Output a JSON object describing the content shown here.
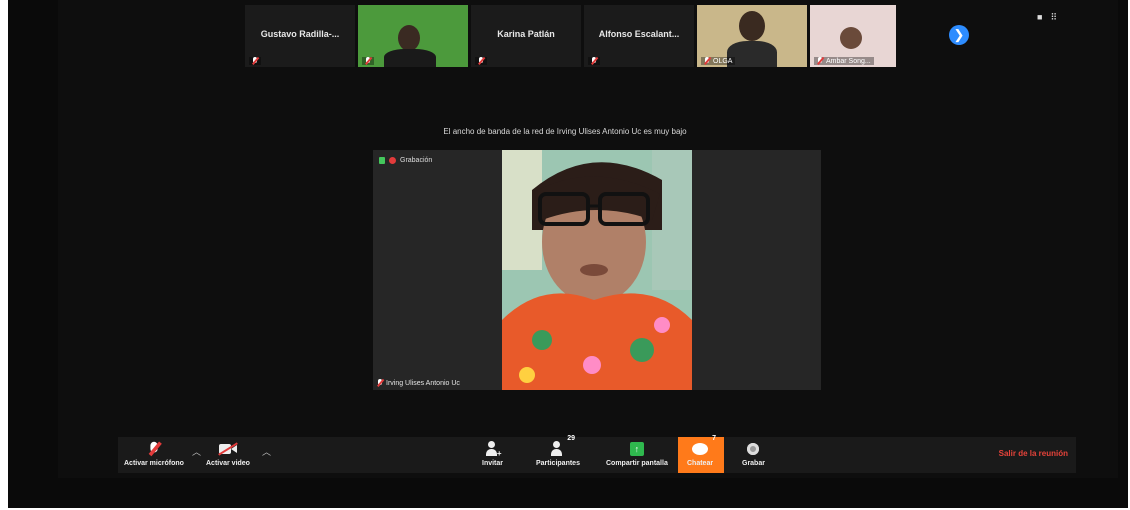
{
  "thumbnails": [
    {
      "name": "Gustavo  Radilla-...",
      "type": "name",
      "tag": ""
    },
    {
      "name": "",
      "type": "video-green",
      "tag": ""
    },
    {
      "name": "Karina Patlán",
      "type": "name",
      "tag": ""
    },
    {
      "name": "Alfonso  Escalant...",
      "type": "name",
      "tag": ""
    },
    {
      "name": "",
      "type": "video-tan",
      "tag": "OLGA"
    },
    {
      "name": "",
      "type": "video-pink",
      "tag": "Ambar Song..."
    }
  ],
  "notice": "El ancho de banda de la red de Irving Ulises Antonio Uc es muy bajo",
  "speaker": {
    "recording_label": "Grabación",
    "name": "Irving Ulises Antonio Uc"
  },
  "toolbar": {
    "mic_label": "Activar micrófono",
    "video_label": "Activar video",
    "invite_label": "Invitar",
    "participants_label": "Participantes",
    "participants_count": "29",
    "share_label": "Compartir pantalla",
    "chat_label": "Chatear",
    "chat_count": "7",
    "record_label": "Grabar",
    "leave_label": "Salir de la reunión"
  },
  "colors": {
    "accent_blue": "#2d8cff",
    "chat_active": "#ff7a1a",
    "leave_red": "#e6433a",
    "share_green": "#2fb84e"
  },
  "icons": [
    "mic-muted-icon",
    "video-off-icon",
    "invite-icon",
    "participants-icon",
    "share-screen-icon",
    "chat-icon",
    "record-icon",
    "next-page-icon",
    "view-toggle-icon"
  ]
}
